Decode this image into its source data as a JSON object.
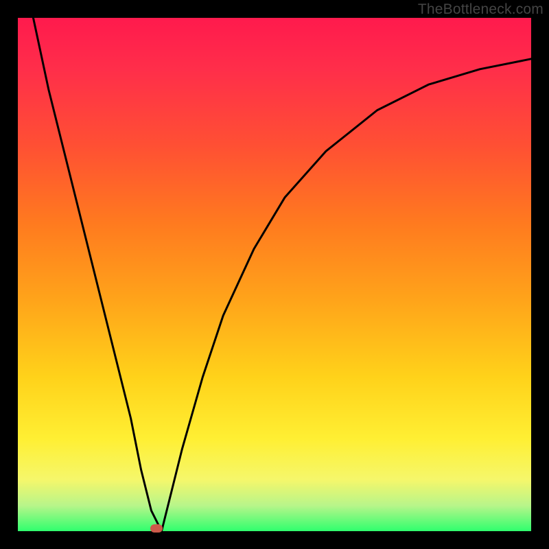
{
  "watermark": "TheBottleneck.com",
  "chart_data": {
    "type": "line",
    "title": "",
    "xlabel": "",
    "ylabel": "",
    "xlim": [
      0,
      100
    ],
    "ylim": [
      0,
      100
    ],
    "grid": false,
    "legend": false,
    "series": [
      {
        "name": "bottleneck-curve",
        "x": [
          3,
          6,
          10,
          14,
          18,
          22,
          24,
          26,
          28,
          32,
          36,
          40,
          46,
          52,
          60,
          70,
          80,
          90,
          100
        ],
        "values": [
          100,
          86,
          70,
          54,
          38,
          22,
          12,
          4,
          0,
          16,
          30,
          42,
          55,
          65,
          74,
          82,
          87,
          90,
          92
        ]
      }
    ],
    "marker": {
      "x": 27,
      "y": 0.5,
      "color": "#cc5a4a"
    },
    "gradient_stops": [
      {
        "pos": 0,
        "color": "#ff1a4d"
      },
      {
        "pos": 40,
        "color": "#ff7a1f"
      },
      {
        "pos": 70,
        "color": "#ffd21a"
      },
      {
        "pos": 100,
        "color": "#2fff6e"
      }
    ]
  }
}
